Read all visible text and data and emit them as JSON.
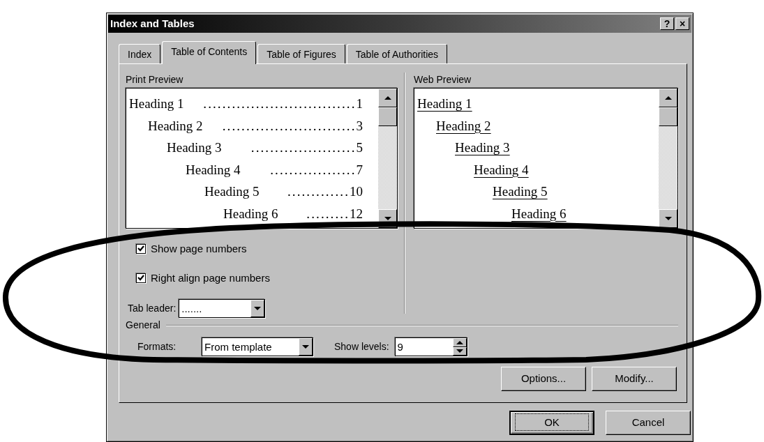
{
  "window": {
    "title": "Index and Tables",
    "title_buttons": [
      "?",
      "×"
    ]
  },
  "tabs": [
    {
      "label": "Index",
      "selected": false
    },
    {
      "label": "Table of Contents",
      "selected": true
    },
    {
      "label": "Table of Figures",
      "selected": false
    },
    {
      "label": "Table of Authorities",
      "selected": false
    }
  ],
  "print_preview": {
    "label": "Print Preview",
    "entries": [
      {
        "text": "Heading 1",
        "leader": "................................",
        "page": "1",
        "children": [
          {
            "text": "Heading 2",
            "leader": "............................",
            "page": "3",
            "children": [
              {
                "text": "Heading 3",
                "leader": "......................",
                "page": "5",
                "children": [
                  {
                    "text": "Heading 4",
                    "leader": "..................",
                    "page": "7",
                    "children": [
                      {
                        "text": "Heading 5",
                        "leader": ".............",
                        "page": "10",
                        "children": [
                          {
                            "text": "Heading 6",
                            "leader": ".........",
                            "page": "12"
                          }
                        ]
                      }
                    ]
                  }
                ]
              }
            ]
          }
        ]
      }
    ]
  },
  "web_preview": {
    "label": "Web Preview",
    "entries": [
      {
        "text": "Heading 1",
        "children": [
          {
            "text": "Heading 2",
            "children": [
              {
                "text": "Heading 3",
                "children": [
                  {
                    "text": "Heading 4",
                    "children": [
                      {
                        "text": "Heading 5",
                        "children": [
                          {
                            "text": "Heading 6"
                          }
                        ]
                      }
                    ]
                  }
                ]
              }
            ]
          }
        ]
      }
    ]
  },
  "checkboxes": [
    {
      "label": "Show page numbers",
      "checked": true
    },
    {
      "label": "Right align page numbers",
      "checked": true
    }
  ],
  "tab_leader": {
    "label": "Tab leader:",
    "value": "......."
  },
  "general": {
    "label": "General",
    "formats": {
      "label": "Formats:",
      "value": "From template"
    },
    "show_levels": {
      "label": "Show levels:",
      "value": "9"
    }
  },
  "panel_buttons": [
    {
      "label": "Options..."
    },
    {
      "label": "Modify..."
    }
  ],
  "dialog_buttons": [
    {
      "label": "OK",
      "default": true
    },
    {
      "label": "Cancel",
      "default": false
    }
  ],
  "annotation": {
    "kind": "ellipse"
  }
}
